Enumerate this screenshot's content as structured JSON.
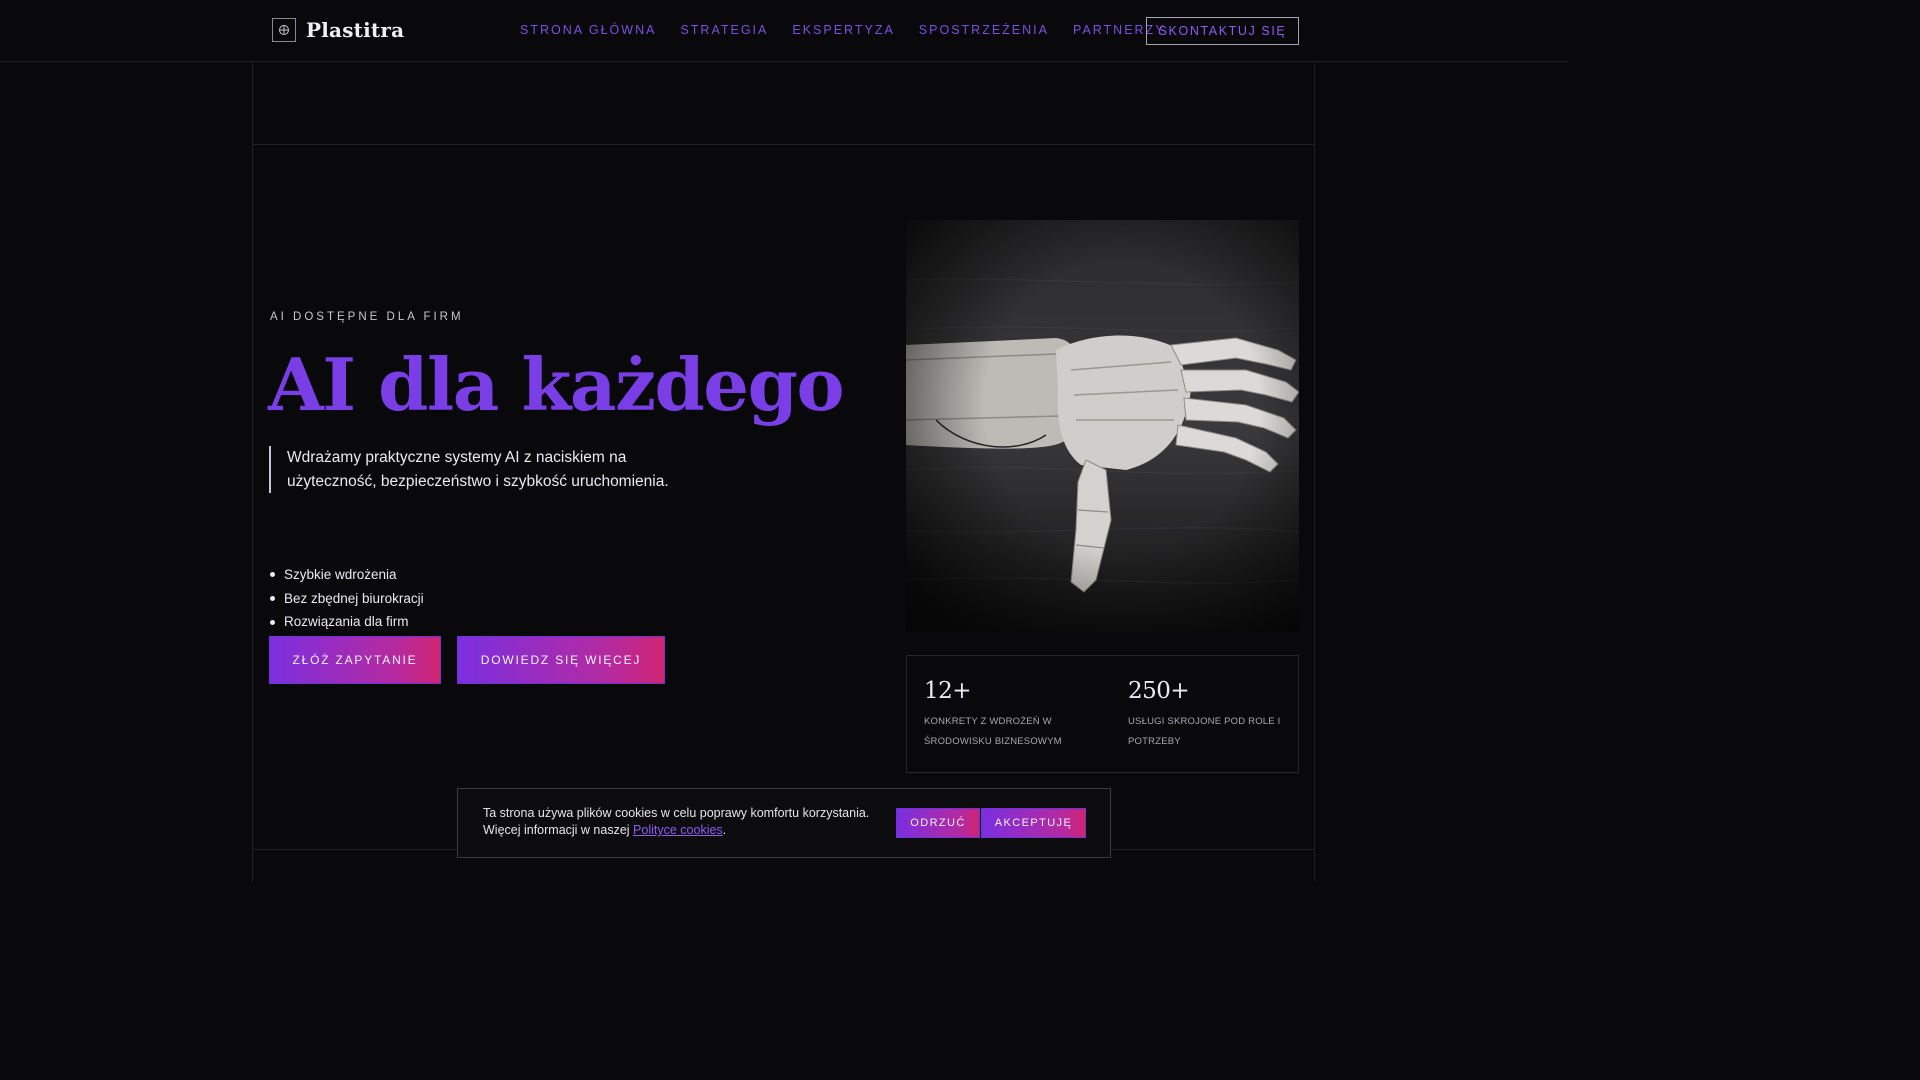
{
  "brand": {
    "name": "Plastitra"
  },
  "nav": {
    "items": [
      {
        "label": "STRONA GŁÓWNA"
      },
      {
        "label": "STRATEGIA"
      },
      {
        "label": "EKSPERTYZA"
      },
      {
        "label": "SPOSTRZEŻENIA"
      },
      {
        "label": "PARTNERZY"
      }
    ],
    "cta_label": "SKONTAKTUJ SIĘ"
  },
  "hero": {
    "eyebrow": "AI DOSTĘPNE DLA FIRM",
    "title": "AI dla każdego",
    "lead": "Wdrażamy praktyczne systemy AI z naciskiem na użyteczność, bezpieczeństwo i szybkość uruchomienia.",
    "bullets": [
      "Szybkie wdrożenia",
      "Bez zbędnej biurokracji",
      "Rozwiązania dla firm"
    ],
    "primary_button": "ZŁÓŻ ZAPYTANIE",
    "secondary_button": "DOWIEDZ SIĘ WIĘCEJ",
    "image_icon": "robotic-hand-photo"
  },
  "stats": [
    {
      "value": "12+",
      "label": "KONKRETY Z WDROŻEŃ W ŚRODOWISKU BIZNESOWYM"
    },
    {
      "value": "250+",
      "label": "USŁUGI SKROJONE POD ROLE I POTRZEBY"
    }
  ],
  "cookie": {
    "text_line1": "Ta strona używa plików cookies w celu poprawy komfortu korzystania.",
    "text_prefix": "Więcej informacji w naszej ",
    "link": "Polityce cookies",
    "text_suffix": ".",
    "reject": "ODRZUĆ",
    "accept": "AKCEPTUJĘ"
  },
  "colors": {
    "background": "#09090b",
    "accent": "#7a3ee6",
    "gradient_start": "#7b2fe0",
    "gradient_end": "#d0236f"
  }
}
